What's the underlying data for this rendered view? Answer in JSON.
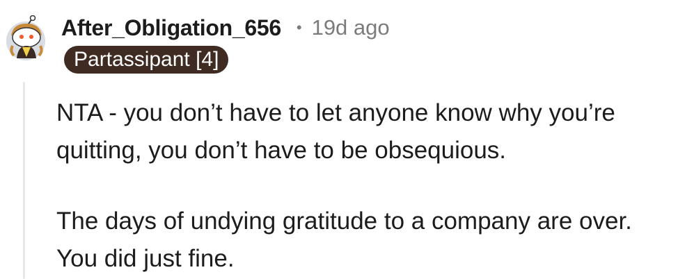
{
  "comment": {
    "author": {
      "username": "After_Obligation_656",
      "avatar_icon": "snoo-avatar-icon",
      "flair": "Partassipant [4]",
      "flair_color": "#3f2b22"
    },
    "separator": "•",
    "timestamp": "19d ago",
    "paragraphs": [
      "NTA - you don’t have to let anyone know why you’re quitting, you don’t have to be obsequious.",
      "The days of undying gratitude to a company are over. You did just fine."
    ]
  }
}
